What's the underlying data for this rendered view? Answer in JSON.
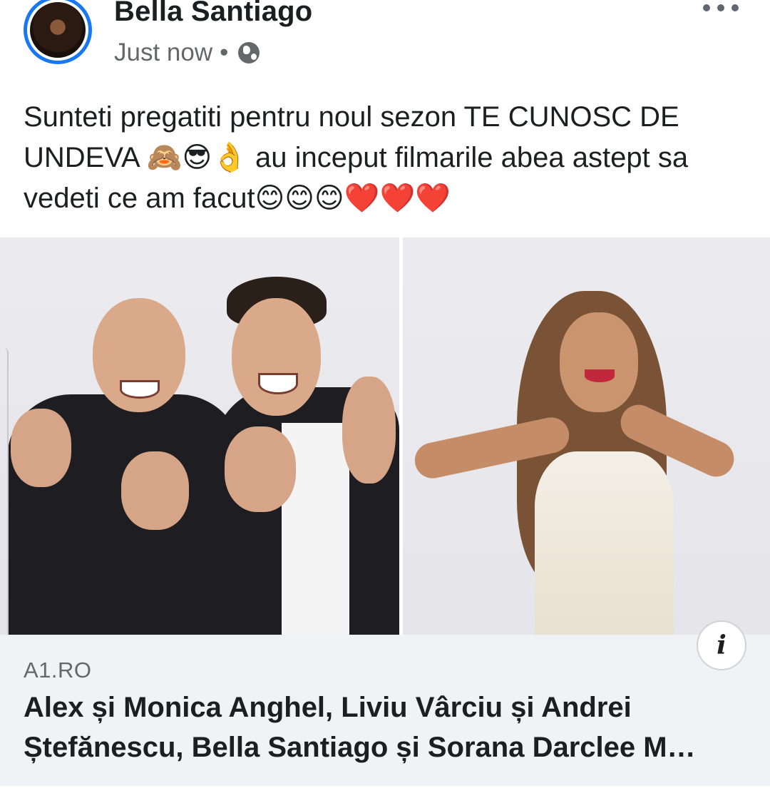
{
  "post": {
    "author_name": "Bella Santiago",
    "timestamp": "Just now",
    "separator": "•",
    "privacy_icon": "globe-icon",
    "more_icon": "more-dots-icon",
    "text": "Sunteti pregatiti pentru noul sezon TE CUNOSC DE UNDEVA 🙈😎👌 au inceput filmarile abea astept sa vedeti ce am facut😊😊😊❤️❤️❤️"
  },
  "link_preview": {
    "domain": "A1.RO",
    "title": "Alex și Monica Anghel, Liviu Vârciu și Andrei Ștefănescu, Bella Santiago și Sorana Darclee M…",
    "info_label": "i"
  },
  "colors": {
    "accent": "#1877f2",
    "text_primary": "#1c1e21",
    "text_secondary": "#65676b",
    "link_background": "#f0f2f5"
  }
}
